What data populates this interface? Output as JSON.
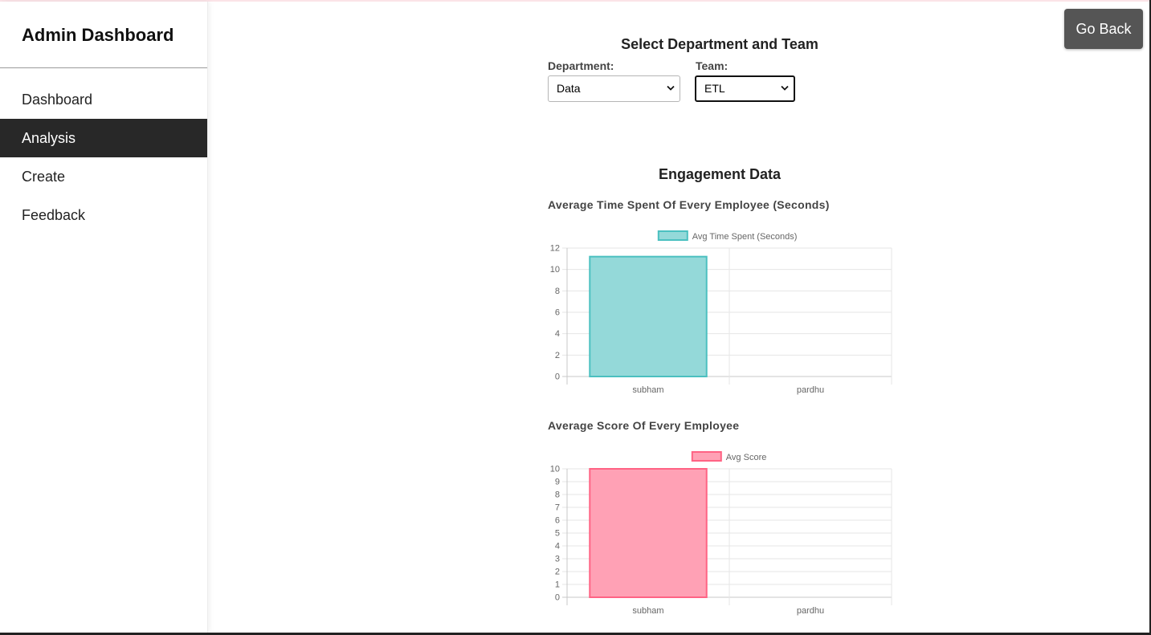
{
  "sidebar": {
    "title": "Admin Dashboard",
    "items": [
      {
        "label": "Dashboard",
        "active": false
      },
      {
        "label": "Analysis",
        "active": true
      },
      {
        "label": "Create",
        "active": false
      },
      {
        "label": "Feedback",
        "active": false
      }
    ]
  },
  "header": {
    "go_back_label": "Go Back"
  },
  "selector": {
    "title": "Select Department and Team",
    "department_label": "Department:",
    "department_value": "Data",
    "team_label": "Team:",
    "team_value": "ETL"
  },
  "engagement": {
    "title": "Engagement Data"
  },
  "chart_data": [
    {
      "type": "bar",
      "title": "Average Time Spent Of Every Employee (Seconds)",
      "categories": [
        "subham",
        "pardhu"
      ],
      "series": [
        {
          "name": "Avg Time Spent (Seconds)",
          "values": [
            11.2,
            0
          ]
        }
      ],
      "ylim": [
        0,
        12
      ],
      "yticks": [
        0,
        2,
        4,
        6,
        8,
        10,
        12
      ],
      "grid": true,
      "legend": "top-center",
      "colors": {
        "fill": "#94d9d9",
        "stroke": "#4bc0c0"
      }
    },
    {
      "type": "bar",
      "title": "Average Score Of Every Employee",
      "categories": [
        "subham",
        "pardhu"
      ],
      "series": [
        {
          "name": "Avg Score",
          "values": [
            10,
            0
          ]
        }
      ],
      "ylim": [
        0,
        10
      ],
      "yticks": [
        0,
        1,
        2,
        3,
        4,
        5,
        6,
        7,
        8,
        9,
        10
      ],
      "grid": true,
      "legend": "top-center",
      "colors": {
        "fill": "#ffa1b5",
        "stroke": "#ff6384"
      }
    }
  ]
}
